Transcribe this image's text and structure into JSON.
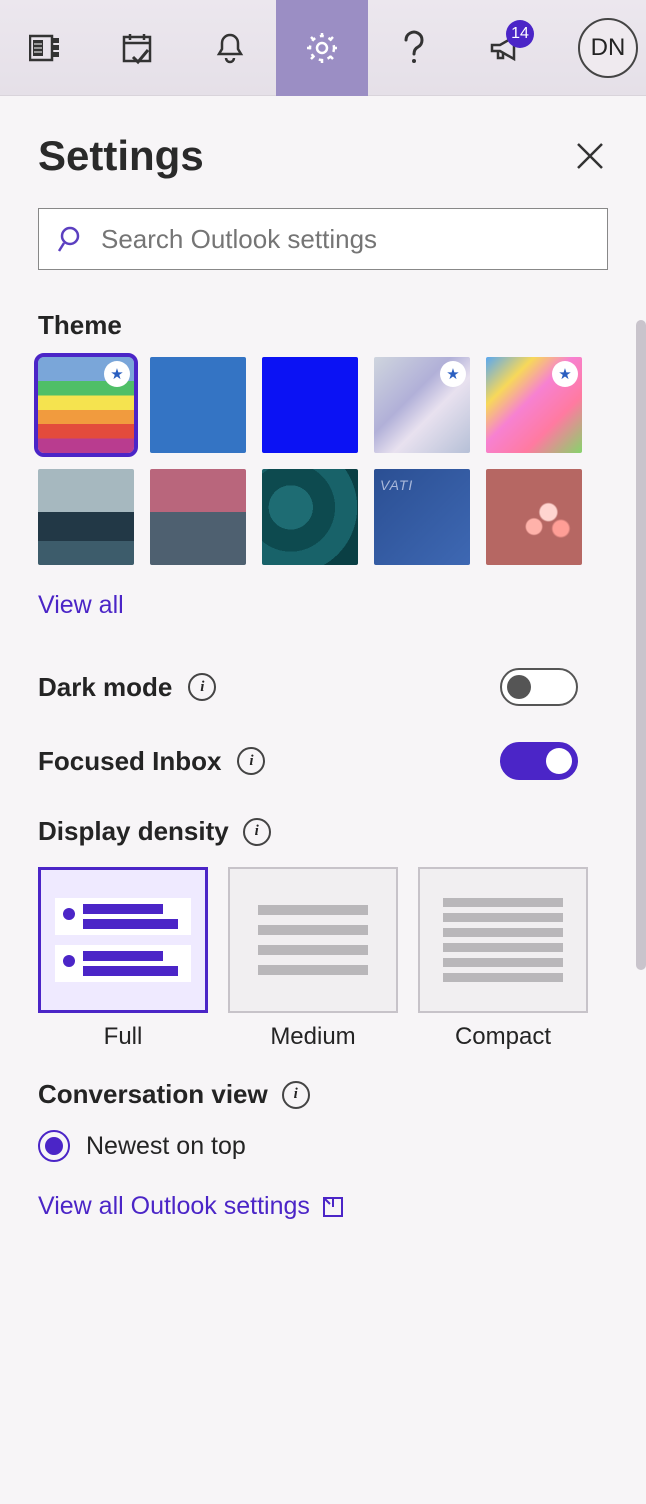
{
  "topbar": {
    "notification_count": "14",
    "avatar_initials": "DN"
  },
  "panel": {
    "title": "Settings",
    "search_placeholder": "Search Outlook settings",
    "theme_label": "Theme",
    "view_all_label": "View all",
    "dark_mode_label": "Dark mode",
    "dark_mode_on": false,
    "focused_inbox_label": "Focused Inbox",
    "focused_inbox_on": true,
    "display_density_label": "Display density",
    "density": {
      "options": [
        {
          "label": "Full",
          "selected": true
        },
        {
          "label": "Medium",
          "selected": false
        },
        {
          "label": "Compact",
          "selected": false
        }
      ]
    },
    "conversation_view_label": "Conversation view",
    "conversation_option": "Newest on top",
    "view_all_settings_label": "View all Outlook settings"
  }
}
